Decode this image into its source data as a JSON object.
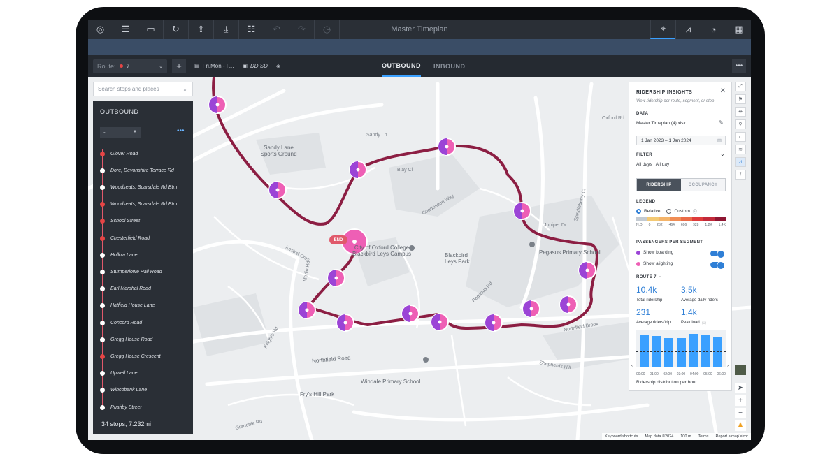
{
  "window": {
    "title": "Master Timeplan"
  },
  "toolbar": {
    "route_label": "Route:",
    "route_value": "7",
    "add_label": "+",
    "schedule": "Fri,Mon - F...",
    "vehicle": "DD,SD",
    "tabs": [
      "OUTBOUND",
      "INBOUND"
    ],
    "more": "•••"
  },
  "search": {
    "placeholder": "Search stops and places"
  },
  "outbound": {
    "title": "OUTBOUND",
    "select_value": "-",
    "more": "•••",
    "stops": [
      {
        "name": "Glover Road",
        "red": true
      },
      {
        "name": "Dore, Devonshire Terrace Rd",
        "red": false
      },
      {
        "name": "Woodseats, Scarsdale Rd Btm",
        "red": false
      },
      {
        "name": "Woodseats, Scarsdale Rd Btm",
        "red": true
      },
      {
        "name": "School Street",
        "red": true
      },
      {
        "name": "Chesterfield Road",
        "red": true
      },
      {
        "name": "Hollow Lane",
        "red": false
      },
      {
        "name": "Stumperlowe Hall Road",
        "red": false
      },
      {
        "name": "Earl Marshal Road",
        "red": false
      },
      {
        "name": "Hatfield House Lane",
        "red": false
      },
      {
        "name": "Concord Road",
        "red": false
      },
      {
        "name": "Gregg House Road",
        "red": false
      },
      {
        "name": "Gregg House Crescent",
        "red": true
      },
      {
        "name": "Upwell Lane",
        "red": false
      },
      {
        "name": "Wincobank Lane",
        "red": false
      },
      {
        "name": "Rushby Street",
        "red": false
      }
    ],
    "footer": "34 stops, 7.232mi"
  },
  "insights": {
    "title": "RIDERSHIP INSIGHTS",
    "subtitle": "View ridership per route, segment, or stop",
    "data_header": "DATA",
    "data_file": "Master Timeplan (4).xlsx",
    "date_range": "1 Jan 2023 – 1 Jan 2024",
    "filter_header": "FILTER",
    "filter_value": "All days | All day",
    "seg_on": "RIDERSHIP",
    "seg_off": "OCCUPANCY",
    "legend_header": "LEGEND",
    "legend_relative": "Relative",
    "legend_custom": "Custom",
    "legend_colors": [
      "#c3cad2",
      "#f3c974",
      "#f4b46a",
      "#f08d55",
      "#ea6b48",
      "#de3b3b",
      "#c22a3a",
      "#8e1632"
    ],
    "legend_ticks": [
      "N.D",
      "0",
      "232",
      "464",
      "696",
      "928",
      "1.2K",
      "1.4K"
    ],
    "pps_header": "PASSENGERS PER SEGMENT",
    "show_boarding": "Show boarding",
    "show_alighting": "Show alighting",
    "boarding_color": "#9b44d6",
    "alighting_color": "#ee5fb5",
    "route_header": "ROUTE 7, -",
    "stats": [
      {
        "value": "10.4k",
        "label": "Total ridership"
      },
      {
        "value": "3.5k",
        "label": "Average daily riders"
      },
      {
        "value": "231",
        "label": "Average riders/trip"
      },
      {
        "value": "1.4k",
        "label": "Peak load"
      }
    ],
    "hour_ticks": [
      "00:00",
      "01:00",
      "02:00",
      "03:00",
      "04:00",
      "05:00",
      "06:00"
    ],
    "hour_values": [
      0.95,
      0.92,
      0.85,
      0.85,
      0.98,
      0.96,
      0.9
    ],
    "caption": "Ridership distribution per hour"
  },
  "map": {
    "end_label": "END",
    "labels": [
      {
        "text": "Sandy Lane Sports Ground",
        "big": true
      },
      {
        "text": "Blackbird Leys Park",
        "big": true
      },
      {
        "text": "Pegasus Primary School",
        "big": true
      },
      {
        "text": "City of Oxford College Blackbird Leys Campus",
        "big": true
      },
      {
        "text": "Windale Primary School",
        "big": true
      },
      {
        "text": "Fry's Hill Park",
        "big": true
      },
      {
        "text": "Northfield Road",
        "big": true
      },
      {
        "text": "Northfield Brook",
        "big": false
      },
      {
        "text": "Oxford Rd",
        "big": false
      },
      {
        "text": "Sandy Ln",
        "big": false
      },
      {
        "text": "Blay Cl",
        "big": false
      },
      {
        "text": "Pegasus Rd",
        "big": false
      },
      {
        "text": "Kestrel Cres",
        "big": false
      },
      {
        "text": "Knights Rd",
        "big": false
      },
      {
        "text": "Grenoble Rd",
        "big": false
      },
      {
        "text": "Cuddesdon Way",
        "big": false
      },
      {
        "text": "Juniper Dr",
        "big": false
      },
      {
        "text": "Spindleberry Cl",
        "big": false
      },
      {
        "text": "Merlin Rd",
        "big": false
      },
      {
        "text": "Shepherds Hill",
        "big": false
      }
    ],
    "attribution": [
      "Keyboard shortcuts",
      "Map data ©2024",
      "100 m",
      "Terms",
      "Report a map error"
    ]
  }
}
